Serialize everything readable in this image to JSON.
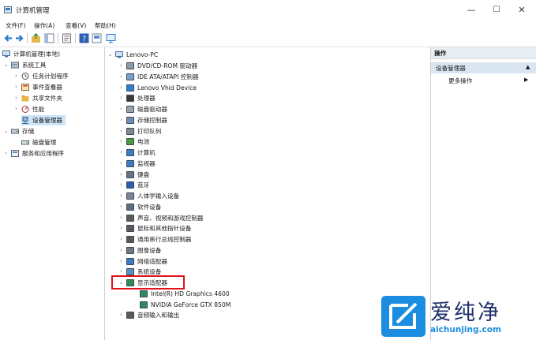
{
  "window": {
    "title": "计算机管理",
    "minimize": "—",
    "maximize": "☐",
    "close": "✕"
  },
  "menubar": [
    "文件(F)",
    "操作(A)",
    "查看(V)",
    "帮助(H)"
  ],
  "left_tree": [
    {
      "label": "计算机管理(本地)",
      "icon": "computer-management-icon",
      "level": 0,
      "arrow": ""
    },
    {
      "label": "系统工具",
      "icon": "system-tools-icon",
      "level": 1,
      "arrow": "⌄"
    },
    {
      "label": "任务计划程序",
      "icon": "task-scheduler-icon",
      "level": 2,
      "arrow": "›"
    },
    {
      "label": "事件查看器",
      "icon": "event-viewer-icon",
      "level": 2,
      "arrow": "›"
    },
    {
      "label": "共享文件夹",
      "icon": "shared-folder-icon",
      "level": 2,
      "arrow": "›"
    },
    {
      "label": "性能",
      "icon": "performance-icon",
      "level": 2,
      "arrow": "›"
    },
    {
      "label": "设备管理器",
      "icon": "device-manager-icon",
      "level": 2,
      "arrow": "",
      "selected": true
    },
    {
      "label": "存储",
      "icon": "storage-icon",
      "level": 1,
      "arrow": "⌄"
    },
    {
      "label": "磁盘管理",
      "icon": "disk-management-icon",
      "level": 2,
      "arrow": ""
    },
    {
      "label": "服务和应用程序",
      "icon": "services-apps-icon",
      "level": 1,
      "arrow": "›"
    }
  ],
  "device_tree": {
    "root": "Lenovo-PC",
    "items": [
      {
        "label": "DVD/CD-ROM 驱动器",
        "icon": "dvd-drive-icon",
        "arrow": "›",
        "level": 1
      },
      {
        "label": "IDE ATA/ATAPI 控制器",
        "icon": "ide-controller-icon",
        "arrow": "›",
        "level": 1
      },
      {
        "label": "Lenovo Vhid Device",
        "icon": "vhid-device-icon",
        "arrow": "›",
        "level": 1
      },
      {
        "label": "处理器",
        "icon": "processor-icon",
        "arrow": "›",
        "level": 1
      },
      {
        "label": "磁盘驱动器",
        "icon": "disk-drive-icon",
        "arrow": "›",
        "level": 1
      },
      {
        "label": "存储控制器",
        "icon": "storage-controller-icon",
        "arrow": "›",
        "level": 1
      },
      {
        "label": "打印队列",
        "icon": "print-queue-icon",
        "arrow": "›",
        "level": 1
      },
      {
        "label": "电池",
        "icon": "battery-icon",
        "arrow": "›",
        "level": 1
      },
      {
        "label": "计算机",
        "icon": "computer-icon",
        "arrow": "›",
        "level": 1
      },
      {
        "label": "监视器",
        "icon": "monitor-icon",
        "arrow": "›",
        "level": 1
      },
      {
        "label": "键盘",
        "icon": "keyboard-icon",
        "arrow": "›",
        "level": 1
      },
      {
        "label": "蓝牙",
        "icon": "bluetooth-icon",
        "arrow": "›",
        "level": 1
      },
      {
        "label": "人体学输入设备",
        "icon": "hid-icon",
        "arrow": "›",
        "level": 1
      },
      {
        "label": "软件设备",
        "icon": "software-device-icon",
        "arrow": "›",
        "level": 1
      },
      {
        "label": "声音、视频和游戏控制器",
        "icon": "sound-icon",
        "arrow": "›",
        "level": 1
      },
      {
        "label": "鼠标和其他指针设备",
        "icon": "mouse-icon",
        "arrow": "›",
        "level": 1
      },
      {
        "label": "通用串行总线控制器",
        "icon": "usb-icon",
        "arrow": "›",
        "level": 1
      },
      {
        "label": "图像设备",
        "icon": "imaging-device-icon",
        "arrow": "›",
        "level": 1
      },
      {
        "label": "网络适配器",
        "icon": "network-adapter-icon",
        "arrow": "›",
        "level": 1
      },
      {
        "label": "系统设备",
        "icon": "system-device-icon",
        "arrow": "›",
        "level": 1
      },
      {
        "label": "显示适配器",
        "icon": "display-adapter-icon",
        "arrow": "⌄",
        "level": 1
      },
      {
        "label": "Intel(R) HD Graphics 4600",
        "icon": "display-adapter-icon",
        "arrow": "",
        "level": 2
      },
      {
        "label": "NVIDIA GeForce GTX 850M",
        "icon": "display-adapter-icon",
        "arrow": "",
        "level": 2
      },
      {
        "label": "音频输入和输出",
        "icon": "audio-io-icon",
        "arrow": "›",
        "level": 1
      }
    ]
  },
  "actions": {
    "header": "操作",
    "section": "设备管理器",
    "section_arrow": "▲",
    "more": "更多操作",
    "more_arrow": "▶"
  },
  "watermark": {
    "brand": "爱纯净",
    "url": "aichunjing.com"
  }
}
